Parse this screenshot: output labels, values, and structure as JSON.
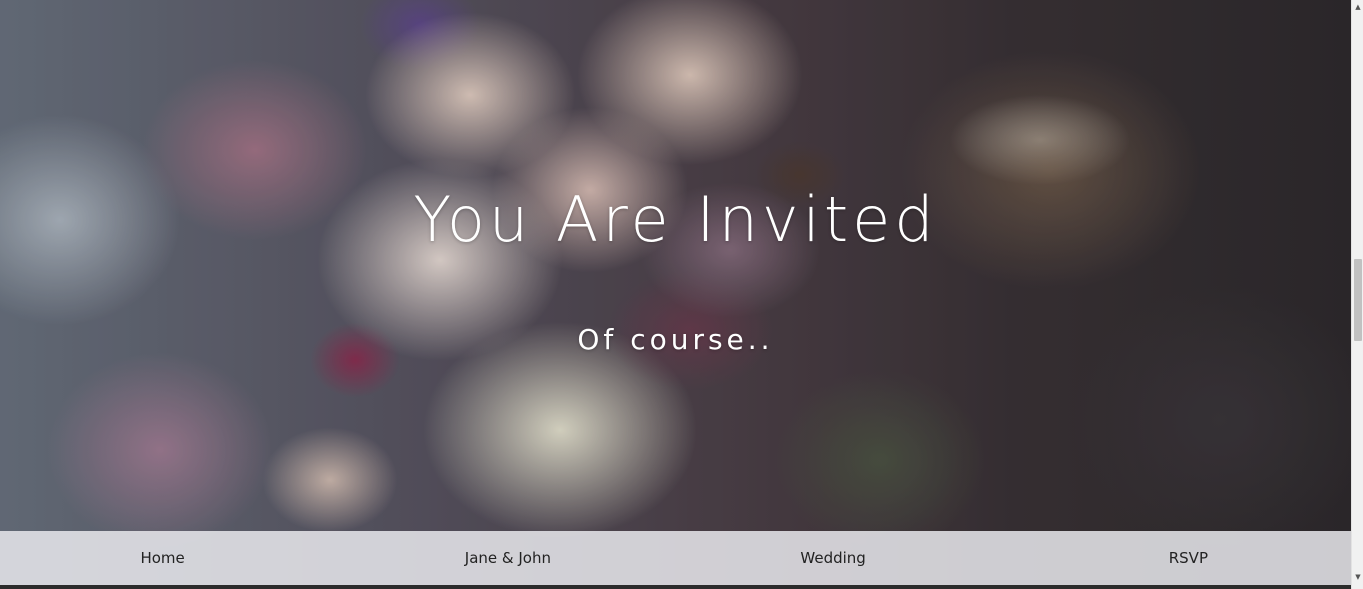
{
  "hero": {
    "title": "You Are Invited",
    "subtitle": "Of course..",
    "background_icon": "flower-bouquet-image"
  },
  "nav": {
    "items": [
      {
        "label": "Home"
      },
      {
        "label": "Jane & John"
      },
      {
        "label": "Wedding"
      },
      {
        "label": "RSVP"
      }
    ]
  },
  "scrollbar": {
    "up_icon": "▲",
    "down_icon": "▼"
  },
  "colors": {
    "text_light": "#ffffff",
    "nav_background": "#e8e8ec",
    "nav_text": "#222222"
  }
}
